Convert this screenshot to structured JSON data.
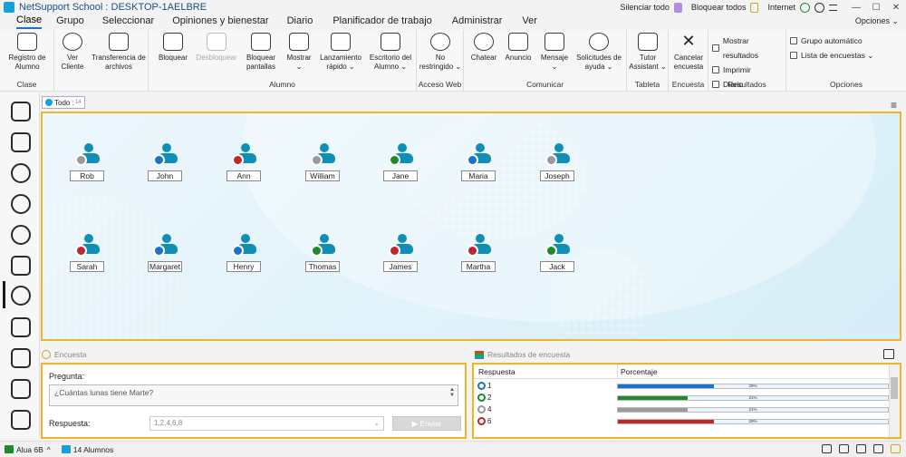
{
  "app": {
    "title": "NetSupport School : DESKTOP-1AELBRE"
  },
  "titlebar": {
    "mute_all": "Silenciar todo",
    "lock_all": "Bloquear todos",
    "internet": "Internet"
  },
  "menu": {
    "tabs": [
      "Clase",
      "Grupo",
      "Seleccionar",
      "Opiniones y bienestar",
      "Diario",
      "Planificador de trabajo",
      "Administrar",
      "Ver"
    ],
    "options": "Opciones"
  },
  "ribbon": {
    "clase": {
      "label": "Clase",
      "buttons": [
        "Registro de Alumno",
        "Ver Cliente",
        "Transferencia de archivos"
      ]
    },
    "alumno": {
      "label": "Alumno",
      "buttons": [
        "Bloquear",
        "Desbloquear",
        "Bloquear pantallas",
        "Mostrar",
        "Lanzamiento rápido",
        "Escritorio del Alumno"
      ]
    },
    "acceso_web": {
      "label": "Acceso Web",
      "buttons": [
        "No restringido"
      ]
    },
    "comunicar": {
      "label": "Comunicar",
      "buttons": [
        "Chatear",
        "Anuncio",
        "Mensaje",
        "Solicitudes de ayuda"
      ]
    },
    "tableta": {
      "label": "Tableta",
      "buttons": [
        "Tutor Assistant"
      ]
    },
    "encuesta": {
      "label": "Encuesta",
      "buttons": [
        "Cancelar encuesta"
      ]
    },
    "resultados": {
      "label": "Resultados",
      "items": [
        "Mostrar resultados",
        "Imprimir",
        "Diario"
      ]
    },
    "opciones": {
      "label": "Opciones",
      "items": [
        "Grupo automático",
        "Lista de encuestas"
      ]
    }
  },
  "group_tab": {
    "label": "Todo",
    "count": "14"
  },
  "students": [
    {
      "name": "Rob",
      "status": "#9a9a9a"
    },
    {
      "name": "John",
      "status": "#1a73c8"
    },
    {
      "name": "Ann",
      "status": "#c0262d"
    },
    {
      "name": "William",
      "status": "#9a9a9a"
    },
    {
      "name": "Jane",
      "status": "#1f8a2a"
    },
    {
      "name": "Maria",
      "status": "#1a73c8"
    },
    {
      "name": "Joseph",
      "status": "#9a9a9a"
    },
    {
      "name": "Sarah",
      "status": "#c0262d"
    },
    {
      "name": "Margaret",
      "status": "#1a73c8"
    },
    {
      "name": "Henry",
      "status": "#1a73c8"
    },
    {
      "name": "Thomas",
      "status": "#1f8a2a"
    },
    {
      "name": "James",
      "status": "#c0262d"
    },
    {
      "name": "Martha",
      "status": "#c0262d"
    },
    {
      "name": "Jack",
      "status": "#1f8a2a"
    }
  ],
  "survey": {
    "title": "Encuesta",
    "question_label": "Pregunta:",
    "question_placeholder": "¿Cuántas lunas tiene Marte?",
    "answer_label": "Respuesta:",
    "answer_value": "1,2,4,6,8",
    "send": "Enviar"
  },
  "results": {
    "title": "Resultados de encuesta",
    "col_answer": "Respuesta",
    "col_percent": "Porcentaje",
    "rows": [
      {
        "answer": "1",
        "percent": 29,
        "label": "29%",
        "color": "#1a73c8"
      },
      {
        "answer": "2",
        "percent": 21,
        "label": "21%",
        "color": "#1f8a2a"
      },
      {
        "answer": "4",
        "percent": 21,
        "label": "21%",
        "color": "#9a9a9a"
      },
      {
        "answer": "6",
        "percent": 29,
        "label": "29%",
        "color": "#c0262d"
      }
    ]
  },
  "statusbar": {
    "room": "Alua 6B",
    "students": "14 Alumnos"
  }
}
